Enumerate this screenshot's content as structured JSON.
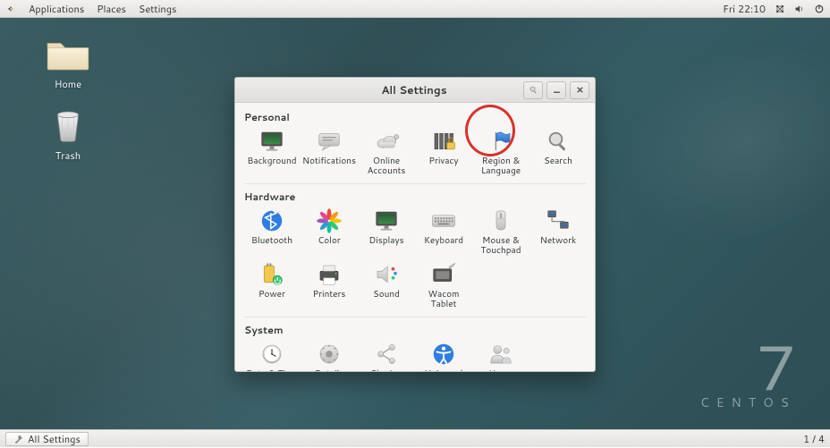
{
  "panel": {
    "menu": [
      "Applications",
      "Places",
      "Settings"
    ],
    "clock": "Fri 22:10"
  },
  "desktop": {
    "icons": [
      {
        "name": "home",
        "label": "Home"
      },
      {
        "name": "trash",
        "label": "Trash"
      }
    ],
    "brand": {
      "version": "7",
      "name": "CENTOS"
    }
  },
  "window": {
    "title": "All Settings",
    "sections": [
      {
        "name": "Personal",
        "items": [
          {
            "id": "background",
            "label": "Background"
          },
          {
            "id": "notifications",
            "label": "Notifications"
          },
          {
            "id": "online-accounts",
            "label": "Online Accounts"
          },
          {
            "id": "privacy",
            "label": "Privacy"
          },
          {
            "id": "region-language",
            "label": "Region & Language"
          },
          {
            "id": "search",
            "label": "Search"
          }
        ]
      },
      {
        "name": "Hardware",
        "items": [
          {
            "id": "bluetooth",
            "label": "Bluetooth"
          },
          {
            "id": "color",
            "label": "Color"
          },
          {
            "id": "displays",
            "label": "Displays"
          },
          {
            "id": "keyboard",
            "label": "Keyboard"
          },
          {
            "id": "mouse-touchpad",
            "label": "Mouse & Touchpad"
          },
          {
            "id": "network",
            "label": "Network"
          },
          {
            "id": "power",
            "label": "Power"
          },
          {
            "id": "printers",
            "label": "Printers"
          },
          {
            "id": "sound",
            "label": "Sound"
          },
          {
            "id": "wacom",
            "label": "Wacom Tablet"
          }
        ]
      },
      {
        "name": "System",
        "items": [
          {
            "id": "date-time",
            "label": "Date & Time"
          },
          {
            "id": "details",
            "label": "Details"
          },
          {
            "id": "sharing",
            "label": "Sharing"
          },
          {
            "id": "universal-access",
            "label": "Universal Access"
          },
          {
            "id": "users",
            "label": "Users"
          }
        ]
      }
    ],
    "highlighted": "region-language"
  },
  "taskbar": {
    "active_task": "All Settings",
    "workspace_indicator": "1 / 4"
  }
}
